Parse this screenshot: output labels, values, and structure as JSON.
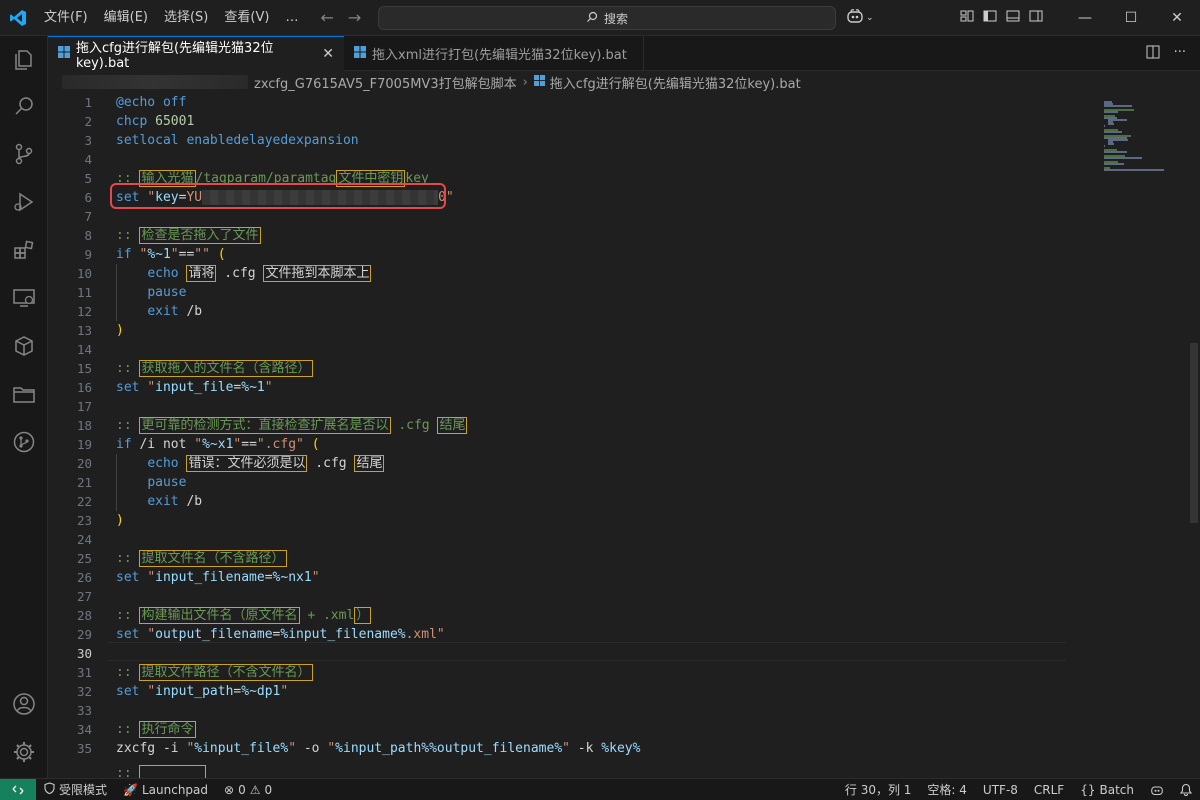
{
  "menu": [
    "文件(F)",
    "编辑(E)",
    "选择(S)",
    "查看(V)",
    "…"
  ],
  "search": {
    "label": "搜索"
  },
  "tabs": [
    {
      "label": "拖入cfg进行解包(先编辑光猫32位key).bat",
      "active": true
    },
    {
      "label": "拖入xml进行打包(先编辑光猫32位key).bat",
      "active": false
    }
  ],
  "breadcrumb": {
    "folder": "zxcfg_G7615AV5_F7005MV3打包解包脚本",
    "file": "拖入cfg进行解包(先编辑光猫32位key).bat"
  },
  "code_lines": [
    {
      "n": 1,
      "t": "@echo off"
    },
    {
      "n": 2,
      "t": "chcp 65001"
    },
    {
      "n": 3,
      "t": "setlocal enabledelayedexpansion"
    },
    {
      "n": 4,
      "t": ""
    },
    {
      "n": 5,
      "t": ":: 输入光猫/tagparam/paramtag文件中密钥key"
    },
    {
      "n": 6,
      "t": "set \"key=YU...0\""
    },
    {
      "n": 7,
      "t": ""
    },
    {
      "n": 8,
      "t": ":: 检查是否拖入了文件"
    },
    {
      "n": 9,
      "t": "if \"%~1\"==\"\" ("
    },
    {
      "n": 10,
      "t": "echo 请将 .cfg 文件拖到本脚本上"
    },
    {
      "n": 11,
      "t": "pause"
    },
    {
      "n": 12,
      "t": "exit /b"
    },
    {
      "n": 13,
      "t": ")"
    },
    {
      "n": 14,
      "t": ""
    },
    {
      "n": 15,
      "t": ":: 获取拖入的文件名（含路径）"
    },
    {
      "n": 16,
      "t": "set \"input_file=%~1\""
    },
    {
      "n": 17,
      "t": ""
    },
    {
      "n": 18,
      "t": ":: 更可靠的检测方式：直接检查扩展名是否以 .cfg 结尾"
    },
    {
      "n": 19,
      "t": "if /i not \"%~x1\"==\".cfg\" ("
    },
    {
      "n": 20,
      "t": "echo 错误：文件必须是以 .cfg 结尾"
    },
    {
      "n": 21,
      "t": "pause"
    },
    {
      "n": 22,
      "t": "exit /b"
    },
    {
      "n": 23,
      "t": ")"
    },
    {
      "n": 24,
      "t": ""
    },
    {
      "n": 25,
      "t": ":: 提取文件名（不含路径）"
    },
    {
      "n": 26,
      "t": "set \"input_filename=%~nx1\""
    },
    {
      "n": 27,
      "t": ""
    },
    {
      "n": 28,
      "t": ":: 构建输出文件名（原文件名 + .xml）"
    },
    {
      "n": 29,
      "t": "set \"output_filename=%input_filename%.xml\""
    },
    {
      "n": 30,
      "t": ""
    },
    {
      "n": 31,
      "t": ":: 提取文件路径（不含文件名）"
    },
    {
      "n": 32,
      "t": "set \"input_path=%~dp1\""
    },
    {
      "n": 33,
      "t": ""
    },
    {
      "n": 34,
      "t": ":: 执行命令"
    },
    {
      "n": 35,
      "t": "zxcfg -i \"%input_file%\" -o \"%input_path%%output_filename%\" -k %key%"
    }
  ],
  "current_line": 30,
  "status": {
    "restricted": "受限模式",
    "launchpad": "Launchpad",
    "errors": "0",
    "warnings": "0",
    "position": "行 30，列 1",
    "spaces": "空格: 4",
    "encoding": "UTF-8",
    "eol": "CRLF",
    "language": "Batch"
  },
  "colors": {
    "accent": "#0078d4",
    "redbox": "#e5484d",
    "remote": "#16825d"
  }
}
